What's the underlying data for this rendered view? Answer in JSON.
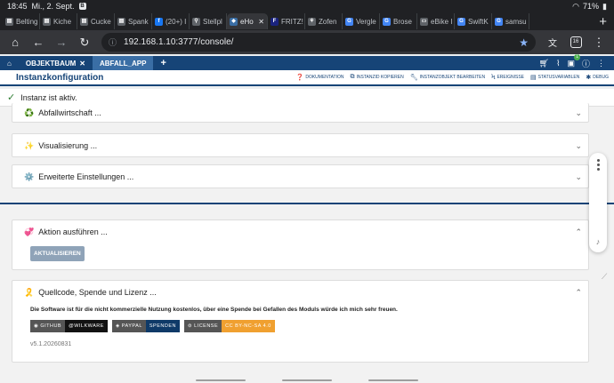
{
  "statusbar": {
    "time": "18:45",
    "date": "Mi., 2. Sept.",
    "battery": "71%"
  },
  "browser_tabs": [
    {
      "label": "Belting",
      "color": "#5f6368",
      "glyph": "▤"
    },
    {
      "label": "Kiche",
      "color": "#5f6368",
      "glyph": "▤"
    },
    {
      "label": "Cucke",
      "color": "#5f6368",
      "glyph": "▤"
    },
    {
      "label": "Spank",
      "color": "#5f6368",
      "glyph": "▤"
    },
    {
      "label": "(20+) I",
      "color": "#1877f2",
      "glyph": "f"
    },
    {
      "label": "Stellpl",
      "color": "#5f6368",
      "glyph": "⚲"
    },
    {
      "label": "eHo",
      "color": "#3a6ea5",
      "glyph": "◆",
      "active": true
    },
    {
      "label": "FRITZ!",
      "color": "#1a237e",
      "glyph": "F"
    },
    {
      "label": "Zofen",
      "color": "#5f6368",
      "glyph": "⚘"
    },
    {
      "label": "Vergle",
      "color": "#4285f4",
      "glyph": "G"
    },
    {
      "label": "Brose",
      "color": "#4285f4",
      "glyph": "G"
    },
    {
      "label": "eBike I",
      "color": "#5f6368",
      "glyph": "▭"
    },
    {
      "label": "SwiftK",
      "color": "#4285f4",
      "glyph": "G"
    },
    {
      "label": "samsu",
      "color": "#4285f4",
      "glyph": "G"
    }
  ],
  "address": {
    "url": "192.168.1.10:3777/console/",
    "tab_count": "16"
  },
  "iobroker": {
    "tabs": [
      "OBJEKTBAUM",
      "ABFALL_APP"
    ],
    "notification_count": "1",
    "page_title": "Instanzkonfiguration",
    "toolbar": [
      "Dokumentation",
      "Instanzid kopieren",
      "Instanzobjekt bearbeiten",
      "Ereignisse",
      "Statusvariablen",
      "Debug"
    ],
    "status": "Instanz ist aktiv."
  },
  "panels": [
    {
      "title": "Abfallwirtschaft ...",
      "icon": "♻️"
    },
    {
      "title": "Visualisierung ...",
      "icon": "✨"
    },
    {
      "title": "Erweiterte Einstellungen ...",
      "icon": "⚙️"
    }
  ],
  "action_panel": {
    "title": "Aktion ausführen ...",
    "icon": "💞",
    "button": "AKTUALISIEREN"
  },
  "license_panel": {
    "title": "Quellcode, Spende und Lizenz ...",
    "icon": "🎗️",
    "text": "Die Software ist für die nicht kommerzielle Nutzung kostenlos, über eine Spende bei Gefallen des Moduls würde ich mich sehr freuen.",
    "shields": [
      {
        "left": "◉ GITHUB",
        "right": "@WILKWARE",
        "lcolor": "#555555",
        "rcolor": "#121212"
      },
      {
        "left": "◈ PAYPAL",
        "right": "SPENDEN",
        "lcolor": "#555555",
        "rcolor": "#0f3a68"
      },
      {
        "left": "⊜ LICENSE",
        "right": "CC BY-NC-SA 4.0",
        "lcolor": "#555555",
        "rcolor": "#f0a030"
      }
    ],
    "version": "v5.1.20260831"
  }
}
